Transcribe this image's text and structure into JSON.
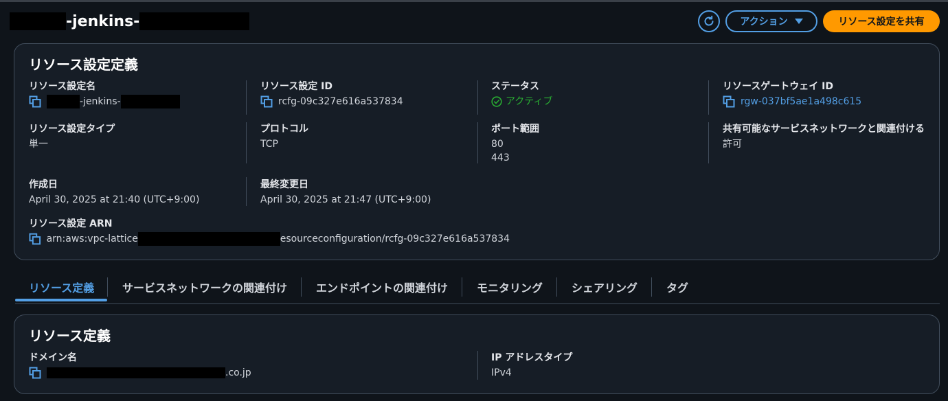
{
  "header": {
    "title_visible": "-jenkins-",
    "refresh_icon": "refresh-icon",
    "action_label": "アクション",
    "share_label": "リソース設定を共有"
  },
  "details": {
    "title": "リソース設定定義",
    "name": {
      "label": "リソース設定名",
      "value_visible": "-jenkins-"
    },
    "id": {
      "label": "リソース設定 ID",
      "value": "rcfg-09c327e616a537834"
    },
    "status": {
      "label": "ステータス",
      "value": "アクティブ"
    },
    "gateway": {
      "label": "リソースゲートウェイ ID",
      "value": "rgw-037bf5ae1a498c615"
    },
    "type": {
      "label": "リソース設定タイプ",
      "value": "単一"
    },
    "protocol": {
      "label": "プロトコル",
      "value": "TCP"
    },
    "ports": {
      "label": "ポート範囲",
      "values": [
        "80",
        "443"
      ]
    },
    "shareable": {
      "label": "共有可能なサービスネットワークと関連付ける",
      "value": "許可"
    },
    "created": {
      "label": "作成日",
      "value": "April 30, 2025 at 21:40 (UTC+9:00)"
    },
    "modified": {
      "label": "最終変更日",
      "value": "April 30, 2025 at 21:47 (UTC+9:00)"
    },
    "arn": {
      "label": "リソース設定 ARN",
      "prefix": "arn:aws:vpc-lattice",
      "suffix": "esourceconfiguration/rcfg-09c327e616a537834"
    }
  },
  "tabs": [
    "リソース定義",
    "サービスネットワークの関連付け",
    "エンドポイントの関連付け",
    "モニタリング",
    "シェアリング",
    "タグ"
  ],
  "definition": {
    "title": "リソース定義",
    "domain": {
      "label": "ドメイン名",
      "suffix": ".co.jp"
    },
    "ip_type": {
      "label": "IP アドレスタイプ",
      "value": "IPv4"
    }
  },
  "colors": {
    "background": "#0f141a",
    "card": "#161d26",
    "accent_blue": "#539fe5",
    "primary_orange": "#ff9900",
    "success_green": "#29ad32"
  }
}
